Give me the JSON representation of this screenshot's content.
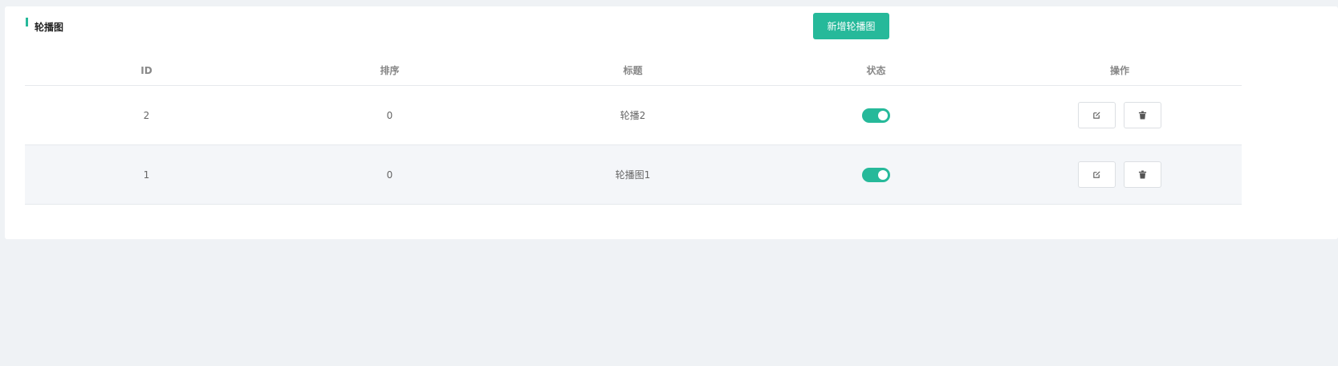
{
  "panel": {
    "title": "轮播图",
    "add_button_label": "新增轮播图"
  },
  "table": {
    "columns": [
      "ID",
      "排序",
      "标题",
      "状态",
      "操作"
    ],
    "rows": [
      {
        "id": "2",
        "sort": "0",
        "title": "轮播2",
        "status_on": true
      },
      {
        "id": "1",
        "sort": "0",
        "title": "轮播图1",
        "status_on": true
      }
    ]
  },
  "icons": {
    "edit": "edit-icon",
    "delete": "trash-icon"
  },
  "colors": {
    "accent": "#26b99a",
    "page_bg": "#eff2f5",
    "alt_row_bg": "#f4f6f9"
  }
}
